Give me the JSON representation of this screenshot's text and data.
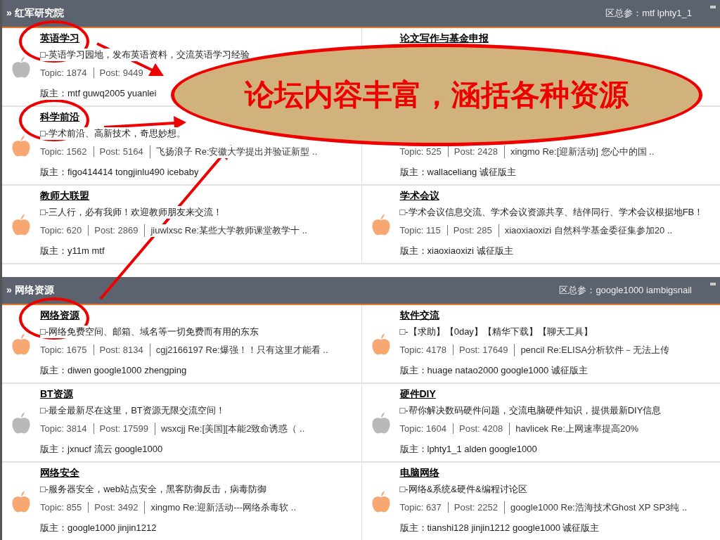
{
  "sections": [
    {
      "title": "» 红军研究院",
      "moderators": "区总参：mtf lphty1_1",
      "forums": [
        {
          "title": "英语学习",
          "circled": true,
          "color": "#b8b8b8",
          "description": "□-英语学习园地，发布英语资料，交流英语学习经验",
          "topics": "Topic: 1874",
          "posts": "Post: 9449",
          "moderators": "版主：mtf guwq2005 yuanlei"
        },
        {
          "title": "论文写作与基金申报",
          "circled": false
        },
        {
          "title": "科学前沿",
          "circled": true,
          "color": "#f7a772",
          "description": "□-学术前沿、高新技术，奇思妙想。",
          "topics": "Topic: 1562",
          "posts": "Post: 5164",
          "last_post": "飞扬浪子 Re:安徽大学提出并验证新型 ..",
          "moderators": "版主：figo414414 tongjinlu490 icebaby"
        },
        {
          "circled": false,
          "topics": "Topic: 525",
          "posts": "Post: 2428",
          "last_post": "xingmo Re:[迎新活动] 您心中的国 ..",
          "moderators": "版主：wallaceliang 诚征版主"
        },
        {
          "title": "教师大联盟",
          "circled": false,
          "color": "#f7a772",
          "description": "□-三人行，必有我师！欢迎教师朋友来交流！",
          "topics": "Topic: 620",
          "posts": "Post: 2869",
          "last_post": "jiuwlxsc Re:某些大学教师课堂教学十 ..",
          "moderators": "版主：y11m mtf"
        },
        {
          "title": "学术会议",
          "circled": false,
          "color": "#f7a772",
          "description": "□-学术会议信息交流、学术会议资源共享、结伴同行、学术会议根据地FB！",
          "topics": "Topic: 115",
          "posts": "Post: 285",
          "last_post": "xiaoxiaoxizi 自然科学基金委征集参加20 ..",
          "moderators": "版主：xiaoxiaoxizi 诚征版主"
        }
      ]
    },
    {
      "title": "» 网络资源",
      "moderators": "区总参：google1000 iambigsnail",
      "forums": [
        {
          "title": "网络资源",
          "circled": true,
          "color": "#f7a772",
          "description": "□-网络免费空间、邮箱、域名等一切免费而有用的东东",
          "topics": "Topic: 1675",
          "posts": "Post: 8134",
          "last_post": "cgj2166197 Re:爆强！！只有这里才能看 ..",
          "moderators": "版主：diwen google1000 zhengping"
        },
        {
          "title": "软件交流",
          "circled": false,
          "color": "#f7a772",
          "description": "□-【求助】【0day】【精华下载】【聊天工具】",
          "topics": "Topic: 4178",
          "posts": "Post: 17649",
          "last_post": "pencil Re:ELISA分析软件－无法上传",
          "moderators": "版主：huage natao2000 google1000 诚征版主"
        },
        {
          "title": "BT资源",
          "circled": false,
          "color": "#b8b8b8",
          "description": "□-最全最新尽在这里，BT资源无限交流空间！",
          "topics": "Topic: 3814",
          "posts": "Post: 17599",
          "last_post": "wsxcjj Re:[美国][本能2致命诱惑（ ..",
          "moderators": "版主：jxnucf 流云 google1000"
        },
        {
          "title": "硬件DIY",
          "circled": false,
          "color": "#b8b8b8",
          "description": "□-帮你解决数码硬件问题，交流电脑硬件知识，提供最新DIY信息",
          "topics": "Topic: 1604",
          "posts": "Post: 4208",
          "last_post": "havlicek Re:上网速率提高20%",
          "moderators": "版主：lphty1_1 alden google1000"
        },
        {
          "title": "网络安全",
          "circled": false,
          "color": "#f7a772",
          "description": "□-服务器安全，web站点安全，黑客防御反击，病毒防御",
          "topics": "Topic: 855",
          "posts": "Post: 3492",
          "last_post": "xingmo Re:迎新活动---网络杀毒软 ..",
          "moderators": "版主：google1000 jinjin1212"
        },
        {
          "title": "电脑网络",
          "circled": false,
          "color": "#f7a772",
          "description": "□-网络&系统&硬件&编程讨论区",
          "topics": "Topic: 637",
          "posts": "Post: 2252",
          "last_post": "google1000 Re:浩海技术Ghost XP SP3纯 ..",
          "moderators": "版主：tianshi128 jinjin1212 google1000 诚征版主"
        }
      ]
    }
  ],
  "callout": {
    "text": "论坛内容丰富，涵括各种资源"
  }
}
